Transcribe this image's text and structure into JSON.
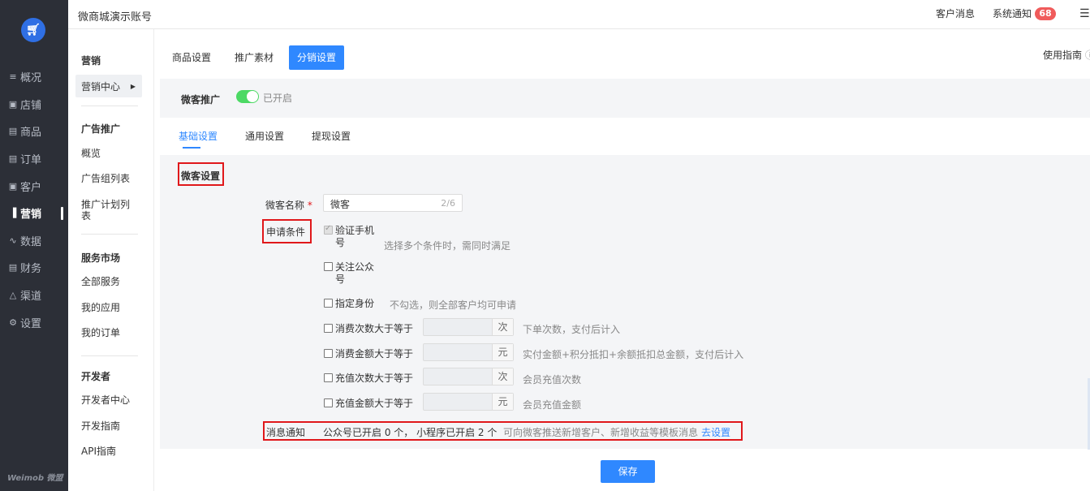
{
  "logo_icon": "cart-icon",
  "sidebar": {
    "items": [
      {
        "label": "概况",
        "icon": "list-icon",
        "glyph": "≡"
      },
      {
        "label": "店铺",
        "icon": "store-icon",
        "glyph": "▣"
      },
      {
        "label": "商品",
        "icon": "goods-icon",
        "glyph": "▤"
      },
      {
        "label": "订单",
        "icon": "order-icon",
        "glyph": "▤"
      },
      {
        "label": "客户",
        "icon": "customer-icon",
        "glyph": "▣"
      },
      {
        "label": "营销",
        "icon": "marketing-icon",
        "glyph": "▐"
      },
      {
        "label": "数据",
        "icon": "data-icon",
        "glyph": "∿"
      },
      {
        "label": "财务",
        "icon": "finance-icon",
        "glyph": "▤"
      },
      {
        "label": "渠道",
        "icon": "channel-icon",
        "glyph": "△"
      },
      {
        "label": "设置",
        "icon": "settings-icon",
        "glyph": "⚙"
      }
    ],
    "brand": "Weimob 微盟"
  },
  "header": {
    "title": "微商城演示账号",
    "messages": "客户消息",
    "notice": "系统通知",
    "badge": "68"
  },
  "subnav": {
    "g1_title": "营销",
    "g1_active": "营销中心",
    "g2_title": "广告推广",
    "g2_items": [
      "概览",
      "广告组列表",
      "推广计划列\n表"
    ],
    "g3_title": "服务市场",
    "g3_items": [
      "全部服务",
      "我的应用",
      "我的订单"
    ],
    "g4_title": "开发者",
    "g4_items": [
      "开发者中心",
      "开发指南",
      "API指南"
    ]
  },
  "tabs": {
    "t1": "商品设置",
    "t2": "推广素材",
    "t3": "分销设置"
  },
  "guide": "使用指南",
  "promo": {
    "label": "微客推广",
    "status": "已开启"
  },
  "subtabs": {
    "t1": "基础设置",
    "t2": "通用设置",
    "t3": "提现设置"
  },
  "section": {
    "title": "微客设置"
  },
  "form": {
    "name_label": "微客名称",
    "name_value": "微客",
    "name_count": "2/6",
    "cond_label": "申请条件",
    "cond1": "验证手机\n号",
    "cond1_hint": "选择多个条件时，需同时满足",
    "cond2": "关注公众\n号",
    "cond3": "指定身份",
    "cond3_hint": "不勾选，则全部客户均可申请",
    "cond4": "消费次数大于等于",
    "cond4_unit": "次",
    "cond4_hint": "下单次数，支付后计入",
    "cond5": "消费金额大于等于",
    "cond5_unit": "元",
    "cond5_hint": "实付金额+积分抵扣+余额抵扣总金额，支付后计入",
    "cond6": "充值次数大于等于",
    "cond6_unit": "次",
    "cond6_hint": "会员充值次数",
    "cond7": "充值金额大于等于",
    "cond7_unit": "元",
    "cond7_hint": "会员充值金额"
  },
  "message": {
    "label": "消息通知",
    "text": "公众号已开启 0 个， 小程序已开启 2 个",
    "hint": "可向微客推送新增客户、新增收益等模板消息",
    "link": "去设置"
  },
  "save": "保存"
}
